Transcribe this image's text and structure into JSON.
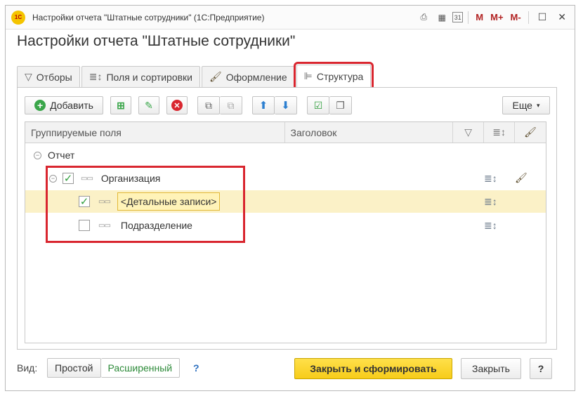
{
  "window": {
    "title": "Настройки отчета \"Штатные сотрудники\"  (1С:Предприятие)",
    "logo_text": "1С",
    "m_labels": [
      "M",
      "M+",
      "M-"
    ],
    "calendar_day": "31"
  },
  "form": {
    "title": "Настройки отчета \"Штатные сотрудники\""
  },
  "tabs": [
    {
      "label": "Отборы",
      "icon": "filter-icon"
    },
    {
      "label": "Поля и сортировки",
      "icon": "sort-icon"
    },
    {
      "label": "Оформление",
      "icon": "brush-icon"
    },
    {
      "label": "Структура",
      "icon": "structure-icon",
      "active": true
    }
  ],
  "toolbar": {
    "add_label": "Добавить",
    "more_label": "Еще"
  },
  "grid": {
    "columns": [
      "Группируемые поля",
      "Заголовок"
    ],
    "rows": [
      {
        "label": "Отчет",
        "level": 0,
        "checkbox": null
      },
      {
        "label": "Организация",
        "level": 1,
        "checked": true
      },
      {
        "label": "<Детальные записи>",
        "level": 2,
        "checked": true,
        "selected": true
      },
      {
        "label": "Подразделение",
        "level": 2,
        "checked": false
      }
    ]
  },
  "bottom": {
    "view_label": "Вид:",
    "view_options": [
      "Простой",
      "Расширенный"
    ],
    "selected_view": "Расширенный",
    "help_mark": "?",
    "primary_label": "Закрыть и сформировать",
    "close_label": "Закрыть",
    "help_label": "?"
  },
  "colors": {
    "accent_yellow": "#f7cc1a",
    "highlight_red": "#d9262f",
    "selected_row": "#fbf1c7",
    "check_green": "#2f9e3c"
  }
}
